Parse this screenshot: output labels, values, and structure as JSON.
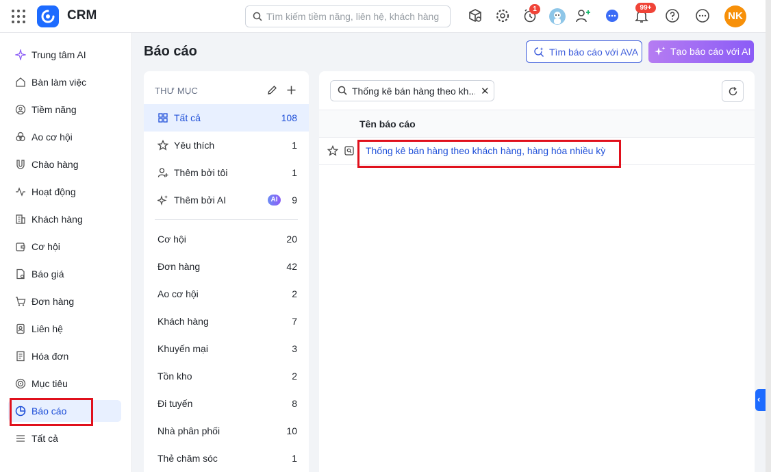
{
  "header": {
    "app_title": "CRM",
    "search_placeholder": "Tìm kiếm tiềm năng, liên hệ, khách hàng",
    "timer_badge": "1",
    "notification_badge": "99+",
    "user_initials": "NK",
    "brand_color": "#1d6bff",
    "avatar_color": "#f79009"
  },
  "sidebar": {
    "items": [
      {
        "label": "Trung tâm AI",
        "icon": "sparkle-icon"
      },
      {
        "label": "Bàn làm việc",
        "icon": "home-icon"
      },
      {
        "label": "Tiềm năng",
        "icon": "target-user-icon"
      },
      {
        "label": "Ao cơ hội",
        "icon": "pool-icon"
      },
      {
        "label": "Chào hàng",
        "icon": "magnet-icon"
      },
      {
        "label": "Hoạt động",
        "icon": "activity-icon"
      },
      {
        "label": "Khách hàng",
        "icon": "building-icon"
      },
      {
        "label": "Cơ hội",
        "icon": "wallet-icon"
      },
      {
        "label": "Báo giá",
        "icon": "quote-icon"
      },
      {
        "label": "Đơn hàng",
        "icon": "cart-icon"
      },
      {
        "label": "Liên hệ",
        "icon": "contact-icon"
      },
      {
        "label": "Hóa đơn",
        "icon": "invoice-icon"
      },
      {
        "label": "Mục tiêu",
        "icon": "goal-icon"
      },
      {
        "label": "Báo cáo",
        "icon": "pie-chart-icon",
        "active": true
      },
      {
        "label": "Tất cả",
        "icon": "menu-icon"
      }
    ]
  },
  "main": {
    "title": "Báo cáo",
    "btn_ava": "Tìm báo cáo với AVA",
    "btn_ai": "Tạo báo cáo với AI"
  },
  "folders": {
    "heading": "THƯ MỤC",
    "special": [
      {
        "label": "Tất cả",
        "count": "108",
        "icon": "grid-icon",
        "active": true
      },
      {
        "label": "Yêu thích",
        "count": "1",
        "icon": "star-icon"
      },
      {
        "label": "Thêm bởi tôi",
        "count": "1",
        "icon": "user-plus-icon"
      },
      {
        "label": "Thêm bởi AI",
        "count": "9",
        "icon": "sparkle-icon",
        "chip": "AI"
      }
    ],
    "categories": [
      {
        "label": "Cơ hội",
        "count": "20"
      },
      {
        "label": "Đơn hàng",
        "count": "42"
      },
      {
        "label": "Ao cơ hội",
        "count": "2"
      },
      {
        "label": "Khách hàng",
        "count": "7"
      },
      {
        "label": "Khuyến mại",
        "count": "3"
      },
      {
        "label": "Tồn kho",
        "count": "2"
      },
      {
        "label": "Đi tuyến",
        "count": "8"
      },
      {
        "label": "Nhà phân phối",
        "count": "10"
      },
      {
        "label": "Thẻ chăm sóc",
        "count": "1"
      }
    ]
  },
  "reports": {
    "search_value": "Thống kê bán hàng theo kh...",
    "column_header": "Tên báo cáo",
    "rows": [
      {
        "name": "Thống kê bán hàng theo khách hàng, hàng hóa nhiều kỳ"
      }
    ]
  },
  "highlight_color": "#e0101c"
}
